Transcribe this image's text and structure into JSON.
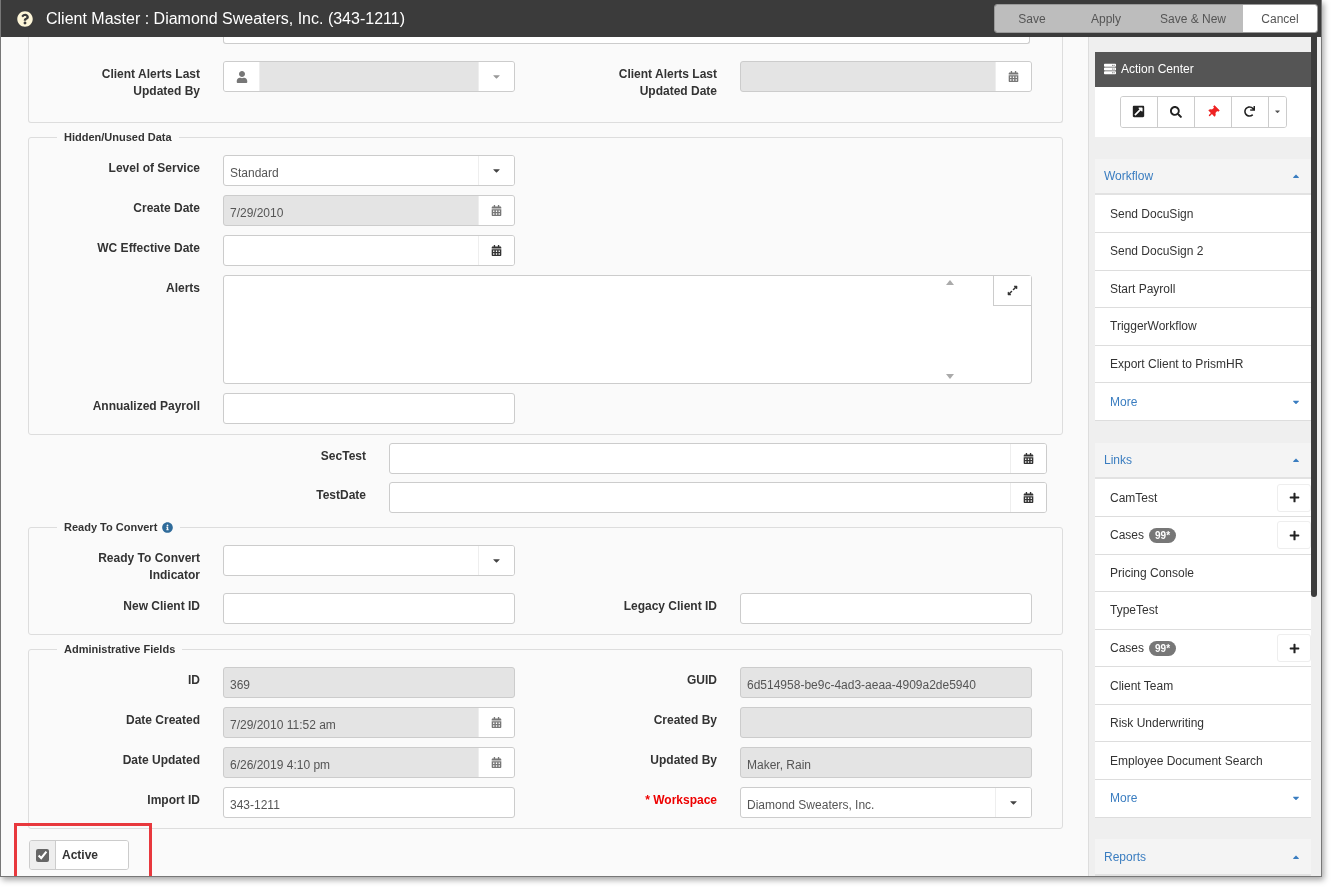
{
  "window": {
    "title": "Client Master : Diamond Sweaters, Inc. (343-1211)"
  },
  "buttons": [
    {
      "label": "Save",
      "kind": "secondary"
    },
    {
      "label": "Apply",
      "kind": "secondary"
    },
    {
      "label": "Save & New",
      "kind": "secondary"
    },
    {
      "label": "Cancel",
      "kind": "cancel"
    }
  ],
  "blocks": [
    {
      "kind": "cut-section",
      "rows": [
        [
          {
            "label": "Client Alerts Last Updated By",
            "kind": "user-select",
            "disabled": true
          },
          {
            "label": "Client Alerts Last Updated Date",
            "kind": "date",
            "disabled": true
          }
        ]
      ]
    },
    {
      "kind": "section",
      "legend": "Hidden/Unused Data",
      "rows": [
        [
          {
            "label": "Level of Service",
            "kind": "select",
            "value": "Standard",
            "disabled": false
          }
        ],
        [
          {
            "label": "Create Date",
            "kind": "date",
            "value": "7/29/2010",
            "disabled": true
          }
        ],
        [
          {
            "label": "WC Effective Date",
            "kind": "date",
            "disabled": false
          }
        ],
        [
          {
            "label": "Alerts",
            "kind": "textarea",
            "disabled": false
          }
        ],
        [
          {
            "label": "Annualized Payroll",
            "kind": "text",
            "disabled": false
          }
        ]
      ]
    },
    {
      "kind": "loose",
      "rows": [
        [
          {
            "label": "SecTest",
            "kind": "date",
            "disabled": false
          }
        ],
        [
          {
            "label": "TestDate",
            "kind": "date",
            "disabled": false
          }
        ]
      ]
    },
    {
      "kind": "section",
      "legend": "Ready To Convert",
      "info": true,
      "rows": [
        [
          {
            "label": "Ready To Convert Indicator",
            "kind": "select",
            "disabled": false
          }
        ],
        [
          {
            "label": "New Client ID",
            "kind": "text",
            "disabled": false
          },
          {
            "label": "Legacy Client ID",
            "kind": "text",
            "disabled": false
          }
        ]
      ]
    },
    {
      "kind": "section",
      "legend": "Administrative Fields",
      "rows": [
        [
          {
            "label": "ID",
            "kind": "text",
            "value": "369",
            "disabled": true
          },
          {
            "label": "GUID",
            "kind": "text",
            "value": "6d514958-be9c-4ad3-aeaa-4909a2de5940",
            "disabled": true
          }
        ],
        [
          {
            "label": "Date Created",
            "kind": "date",
            "value": "7/29/2010 11:52 am",
            "disabled": true
          },
          {
            "label": "Created By",
            "kind": "text",
            "disabled": true
          }
        ],
        [
          {
            "label": "Date Updated",
            "kind": "date",
            "value": "6/26/2019 4:10 pm",
            "disabled": true
          },
          {
            "label": "Updated By",
            "kind": "text",
            "value": "Maker, Rain",
            "disabled": true
          }
        ],
        [
          {
            "label": "Import ID",
            "kind": "text",
            "value": "343-1211",
            "disabled": false
          },
          {
            "label": "* Workspace",
            "kind": "select",
            "value": "Diamond Sweaters, Inc.",
            "disabled": false,
            "required": true
          }
        ]
      ]
    }
  ],
  "active": {
    "label": "Active",
    "checked": true,
    "highlighted": true
  },
  "action_center": {
    "title": "Action Center",
    "groups": [
      {
        "title": "Workflow",
        "expanded": true,
        "items": [
          {
            "label": "Send DocuSign",
            "kind": "item"
          },
          {
            "label": "Send DocuSign 2",
            "kind": "item"
          },
          {
            "label": "Start Payroll",
            "kind": "item"
          },
          {
            "label": "TriggerWorkflow",
            "kind": "item"
          },
          {
            "label": "Export Client to PrismHR",
            "kind": "item"
          },
          {
            "label": "More",
            "kind": "more"
          }
        ]
      },
      {
        "title": "Links",
        "expanded": true,
        "items": [
          {
            "label": "CamTest",
            "kind": "item",
            "addable": true
          },
          {
            "label": "Cases",
            "kind": "item",
            "badge": "99*",
            "addable": true
          },
          {
            "label": "Pricing Console",
            "kind": "item"
          },
          {
            "label": "TypeTest",
            "kind": "item"
          },
          {
            "label": "Cases",
            "kind": "item",
            "badge": "99*",
            "addable": true
          },
          {
            "label": "Client Team",
            "kind": "item"
          },
          {
            "label": "Risk Underwriting",
            "kind": "item"
          },
          {
            "label": "Employee Document Search",
            "kind": "item"
          },
          {
            "label": "More",
            "kind": "more"
          }
        ]
      },
      {
        "title": "Reports",
        "expanded": true
      }
    ]
  }
}
